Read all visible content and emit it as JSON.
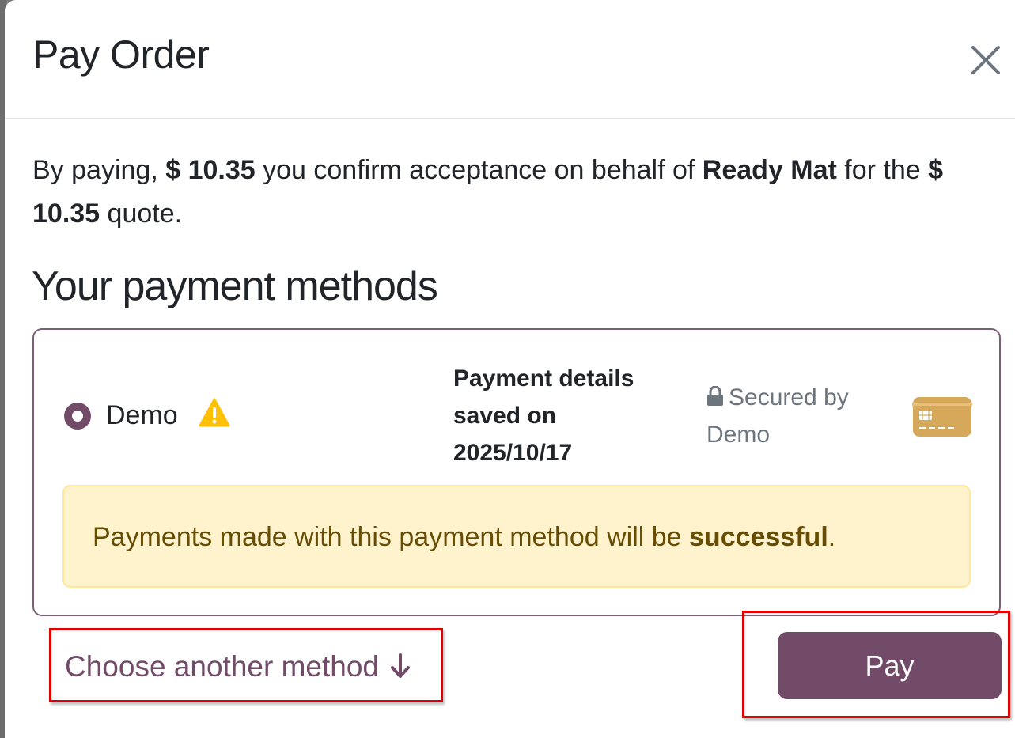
{
  "modal": {
    "title": "Pay Order",
    "close_label": "×"
  },
  "intro": {
    "part1": "By paying, ",
    "amount": "$ 10.35",
    "part2": " you confirm acceptance on behalf of ",
    "company": "Ready Mat",
    "part3": " for the ",
    "quote_amount": "$ 10.35",
    "part4": " quote."
  },
  "payment_methods": {
    "heading": "Your payment methods",
    "items": [
      {
        "name": "Demo",
        "selected": true,
        "warning_icon": "warning-triangle-icon",
        "saved_details": "Payment details saved on 2025/10/17",
        "secured_by": "Secured by Demo",
        "lock_icon": "lock-icon",
        "card_icon": "credit-card-icon",
        "alert": {
          "part1": "Payments made with this payment method will be ",
          "bold": "successful",
          "part2": "."
        }
      }
    ]
  },
  "actions": {
    "choose_another": "Choose another method",
    "choose_icon": "arrow-down-icon",
    "pay": "Pay"
  },
  "colors": {
    "brand": "#714b67",
    "alert_bg": "#fff3cd",
    "alert_text": "#664d03",
    "warning": "#ffc107",
    "card": "#d6a85a",
    "highlight_box": "#e00000"
  }
}
